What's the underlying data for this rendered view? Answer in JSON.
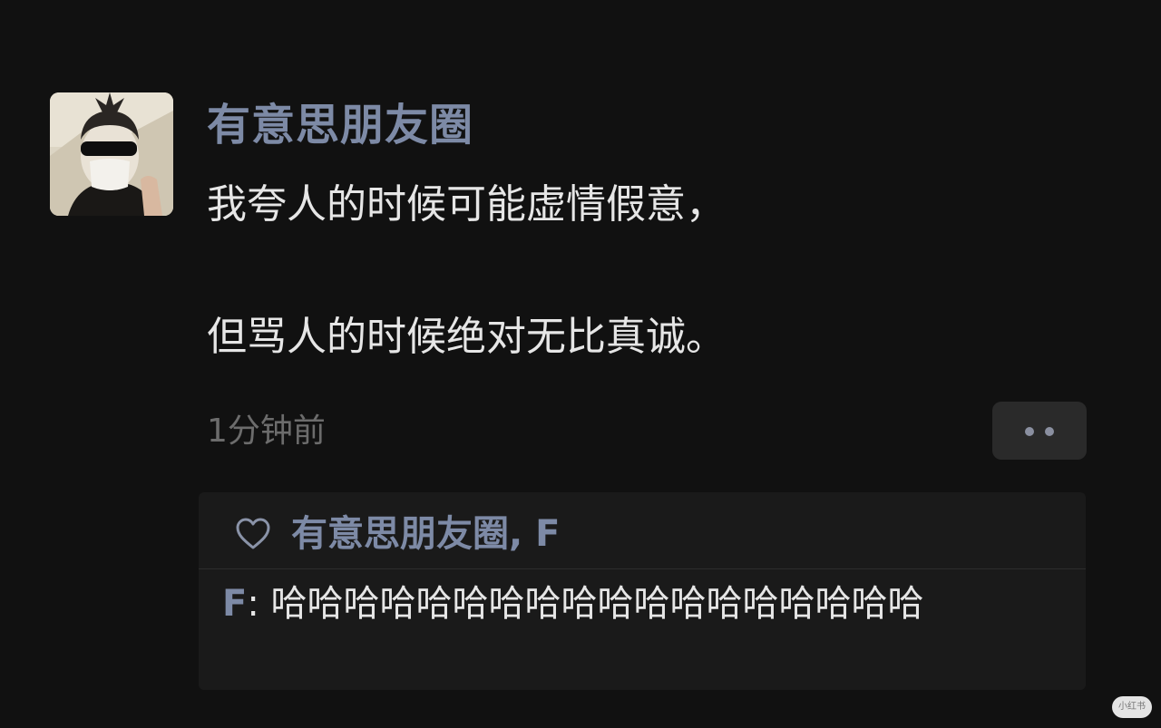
{
  "post": {
    "nickname": "有意思朋友圈",
    "content_line1": "我夸人的时候可能虚情假意，",
    "content_line2": "但骂人的时候绝对无比真诚。",
    "timestamp": "1分钟前",
    "more_icon": "more-dots-icon"
  },
  "interaction": {
    "like_icon": "heart-icon",
    "liked_by": "有意思朋友圈, F",
    "comments": [
      {
        "author": "F",
        "separator": ": ",
        "text": "哈哈哈哈哈哈哈哈哈哈哈哈哈哈哈哈哈哈"
      }
    ]
  },
  "watermark": {
    "text": "小红书"
  },
  "colors": {
    "background": "#111111",
    "nickname": "#7d8aa6",
    "content_text": "#e6e6e6",
    "timestamp": "#6c6c6c",
    "panel": "#1a1a1a"
  }
}
